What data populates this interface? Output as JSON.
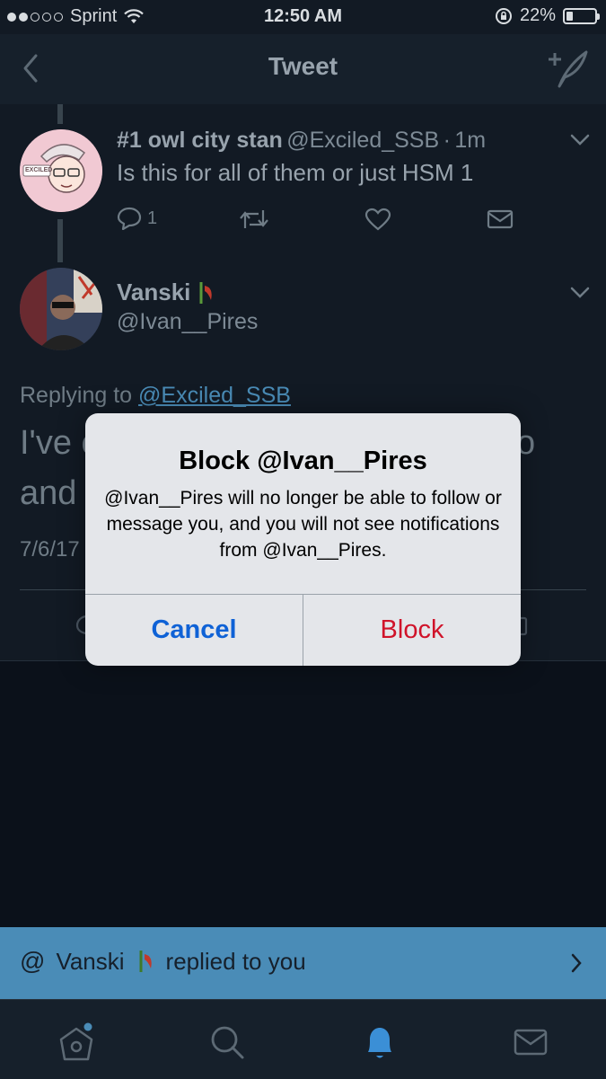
{
  "status_bar": {
    "carrier": "Sprint",
    "time": "12:50 AM",
    "battery": "22%",
    "battery_level": 0.22
  },
  "nav": {
    "title": "Tweet",
    "back_icon": "chevron-left-icon",
    "compose_icon": "compose-feather-icon"
  },
  "parent_tweet": {
    "name": "#1 owl city stan",
    "handle": "@Exciled_SSB",
    "dot": "·",
    "time": "1m",
    "text": "Is this for all of them or just HSM 1",
    "avatar_text": "EXCILED",
    "reply_count": "1"
  },
  "main_tweet": {
    "name": "Vanski",
    "handle": "@Ivan__Pires",
    "replying_prefix": "Replying to",
    "replying_to": "@Exciled_SSB",
    "text_line1": "I've c",
    "text_line1_end": "o",
    "text_line2": "and",
    "date": "7/6/17"
  },
  "dialog": {
    "title": "Block @Ivan__Pires",
    "message": "@Ivan__Pires will no longer be able to follow or message you, and you will not see notifications from @Ivan__Pires.",
    "cancel_label": "Cancel",
    "block_label": "Block"
  },
  "banner": {
    "at_symbol": "@",
    "name": "Vanski",
    "text": "replied to you"
  },
  "colors": {
    "accent_blue": "#0f62d6",
    "destructive_red": "#d0132a",
    "banner_blue": "#4a8cb7"
  }
}
